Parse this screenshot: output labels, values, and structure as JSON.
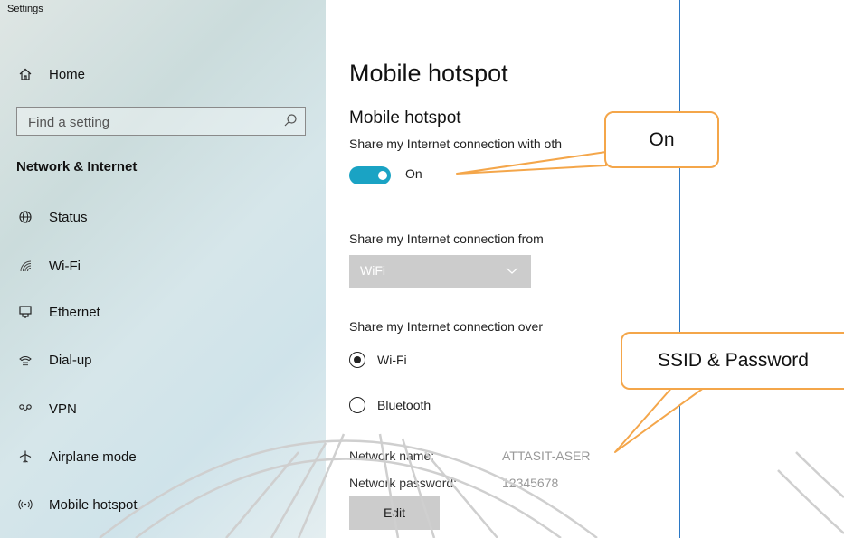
{
  "window": {
    "title": "Settings"
  },
  "sidebar": {
    "home_label": "Home",
    "search_placeholder": "Find a setting",
    "section_heading": "Network & Internet",
    "items": [
      {
        "label": "Status",
        "icon": "globe-icon"
      },
      {
        "label": "Wi-Fi",
        "icon": "wifi-icon"
      },
      {
        "label": "Ethernet",
        "icon": "ethernet-icon"
      },
      {
        "label": "Dial-up",
        "icon": "dialup-icon"
      },
      {
        "label": "VPN",
        "icon": "vpn-icon"
      },
      {
        "label": "Airplane mode",
        "icon": "airplane-icon"
      },
      {
        "label": "Mobile hotspot",
        "icon": "hotspot-icon"
      }
    ]
  },
  "main": {
    "page_title": "Mobile hotspot",
    "section_title": "Mobile hotspot",
    "share_label": "Share my Internet connection with oth",
    "toggle_state": "On",
    "share_from_label": "Share my Internet connection from",
    "share_from_value": "WiFi",
    "share_over_label": "Share my Internet connection over",
    "radio_options": [
      {
        "label": "Wi-Fi",
        "selected": true
      },
      {
        "label": "Bluetooth",
        "selected": false
      }
    ],
    "network_name_label": "Network name:",
    "network_name_value": "ATTASIT-ASER",
    "network_password_label": "Network password:",
    "network_password_value": "12345678",
    "edit_label": "Edit"
  },
  "annotations": {
    "on_callout": "On",
    "ssid_callout": "SSID & Password"
  },
  "colors": {
    "toggle_accent": "#1aa3c4",
    "callout_border": "#f4a64a",
    "window_border": "#2b78c5"
  }
}
